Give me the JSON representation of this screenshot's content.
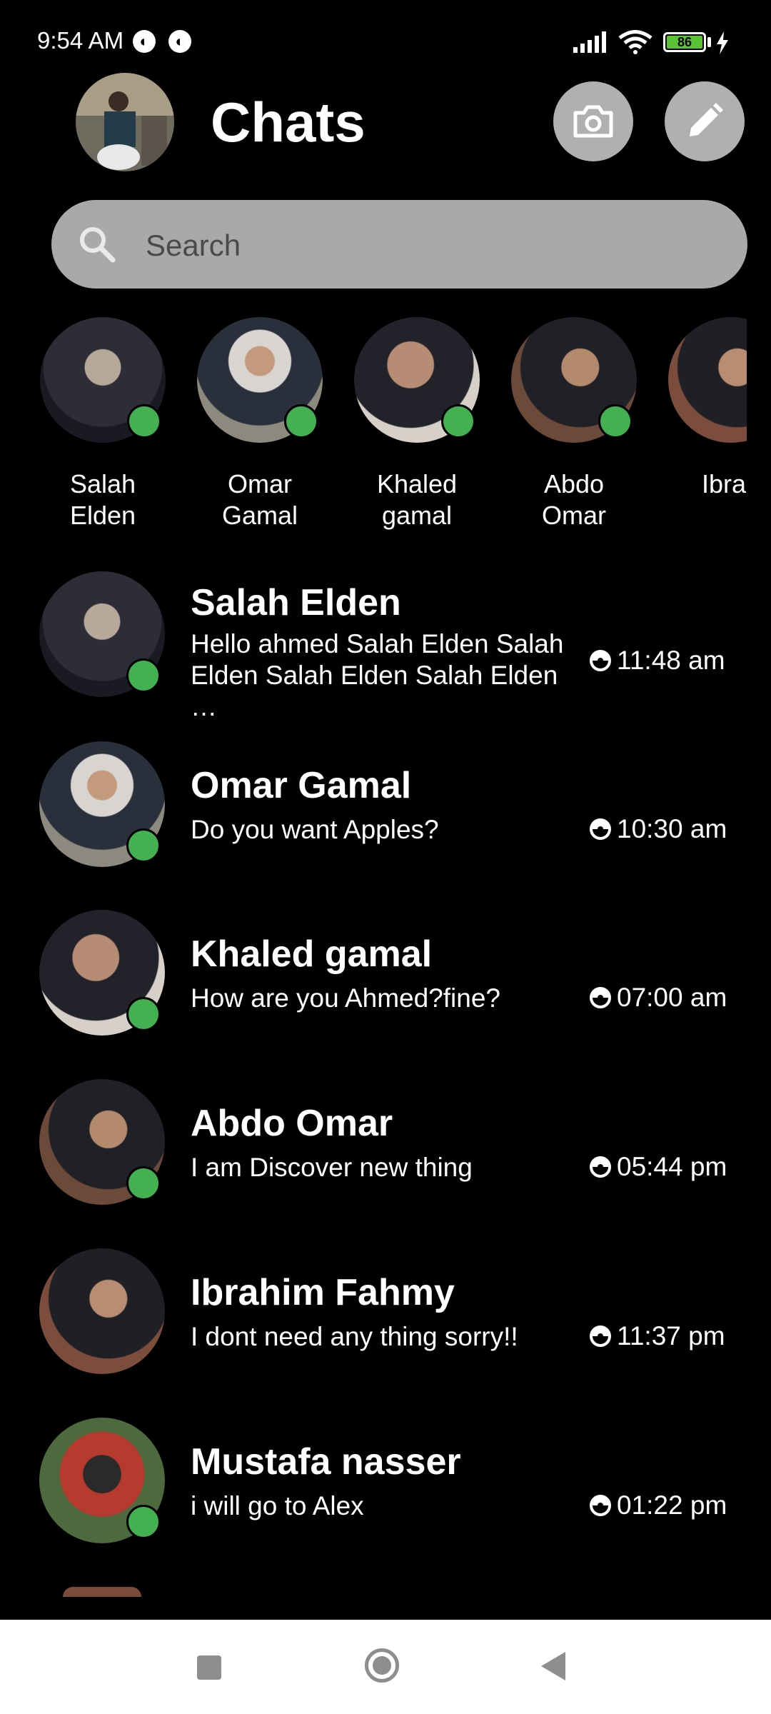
{
  "status_bar": {
    "time": "9:54 AM",
    "battery": "86",
    "badge_icons": [
      "notification-icon",
      "notification-icon"
    ]
  },
  "header": {
    "title": "Chats",
    "camera_icon": "camera-icon",
    "compose_icon": "pencil-icon"
  },
  "search": {
    "placeholder": "Search"
  },
  "stories": [
    {
      "name": "Salah\nElden"
    },
    {
      "name": "Omar\nGamal"
    },
    {
      "name": "Khaled\ngamal"
    },
    {
      "name": "Abdo\nOmar"
    },
    {
      "name": "Ibrah\nFahm"
    }
  ],
  "chats": [
    {
      "name": "Salah Elden",
      "message": "Hello ahmed Salah Elden Salah Elden Salah Elden Salah Elden …",
      "time": "11:48 am"
    },
    {
      "name": "Omar Gamal",
      "message": "Do you want Apples?",
      "time": "10:30 am"
    },
    {
      "name": "Khaled gamal",
      "message": "How are you Ahmed?fine?",
      "time": "07:00 am"
    },
    {
      "name": "Abdo Omar",
      "message": "I am Discover new thing",
      "time": "05:44 pm"
    },
    {
      "name": "Ibrahim Fahmy",
      "message": "I dont need any thing sorry!!",
      "time": "11:37 pm"
    },
    {
      "name": "Mustafa nasser",
      "message": "i will go to Alex",
      "time": "01:22 pm"
    }
  ],
  "colors": {
    "background": "#000000",
    "online": "#43b052",
    "search_bg": "#a9a9a9",
    "button_bg": "#b0b0b0"
  }
}
